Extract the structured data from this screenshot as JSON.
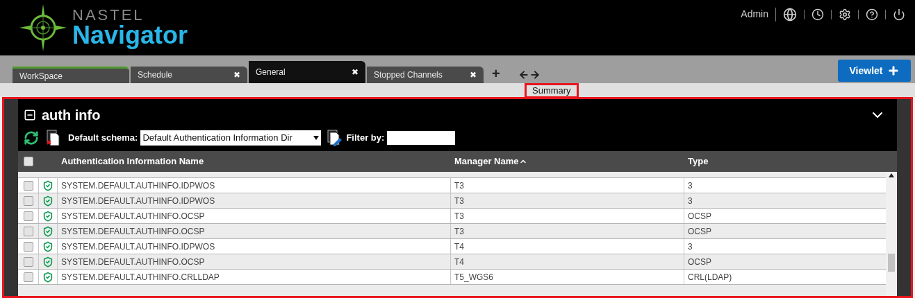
{
  "header": {
    "logo_top": "NASTEL",
    "logo_bottom": "Navigator",
    "user": "Admin"
  },
  "tabs": [
    {
      "label": "WorkSpace",
      "kind": "home",
      "selected": false
    },
    {
      "label": "Schedule",
      "kind": "closable",
      "selected": false,
      "close": "✖"
    },
    {
      "label": "General",
      "kind": "closable",
      "selected": true,
      "close": "✖"
    },
    {
      "label": "Stopped Channels",
      "kind": "closable",
      "selected": false,
      "close": "✖"
    }
  ],
  "add_tab": "+",
  "viewlet_button": "Viewlet",
  "sub_tab": {
    "label": "Summary",
    "highlighted": true
  },
  "panel": {
    "title": "auth info",
    "highlighted": true,
    "schema_label": "Default schema:",
    "schema_value": "Default Authentication Information Dir",
    "filter_label": "Filter by:"
  },
  "table": {
    "select_all_checked": false,
    "columns": [
      {
        "label": "Authentication Information Name",
        "sorted": false
      },
      {
        "label": "Manager Name",
        "sorted": true
      },
      {
        "label": "Type",
        "sorted": false
      }
    ],
    "rows": [
      {
        "checked": false,
        "name": "SYSTEM.DEFAULT.AUTHINFO.IDPWOS",
        "manager": "T3",
        "type": "3"
      },
      {
        "checked": false,
        "name": "SYSTEM.DEFAULT.AUTHINFO.IDPWOS",
        "manager": "T3",
        "type": "3"
      },
      {
        "checked": false,
        "name": "SYSTEM.DEFAULT.AUTHINFO.OCSP",
        "manager": "T3",
        "type": "OCSP"
      },
      {
        "checked": false,
        "name": "SYSTEM.DEFAULT.AUTHINFO.OCSP",
        "manager": "T3",
        "type": "OCSP"
      },
      {
        "checked": false,
        "name": "SYSTEM.DEFAULT.AUTHINFO.IDPWOS",
        "manager": "T4",
        "type": "3"
      },
      {
        "checked": false,
        "name": "SYSTEM.DEFAULT.AUTHINFO.OCSP",
        "manager": "T4",
        "type": "OCSP"
      },
      {
        "checked": false,
        "name": "SYSTEM.DEFAULT.AUTHINFO.CRLLDAP",
        "manager": "T5_WGS6",
        "type": "CRL(LDAP)"
      }
    ]
  }
}
